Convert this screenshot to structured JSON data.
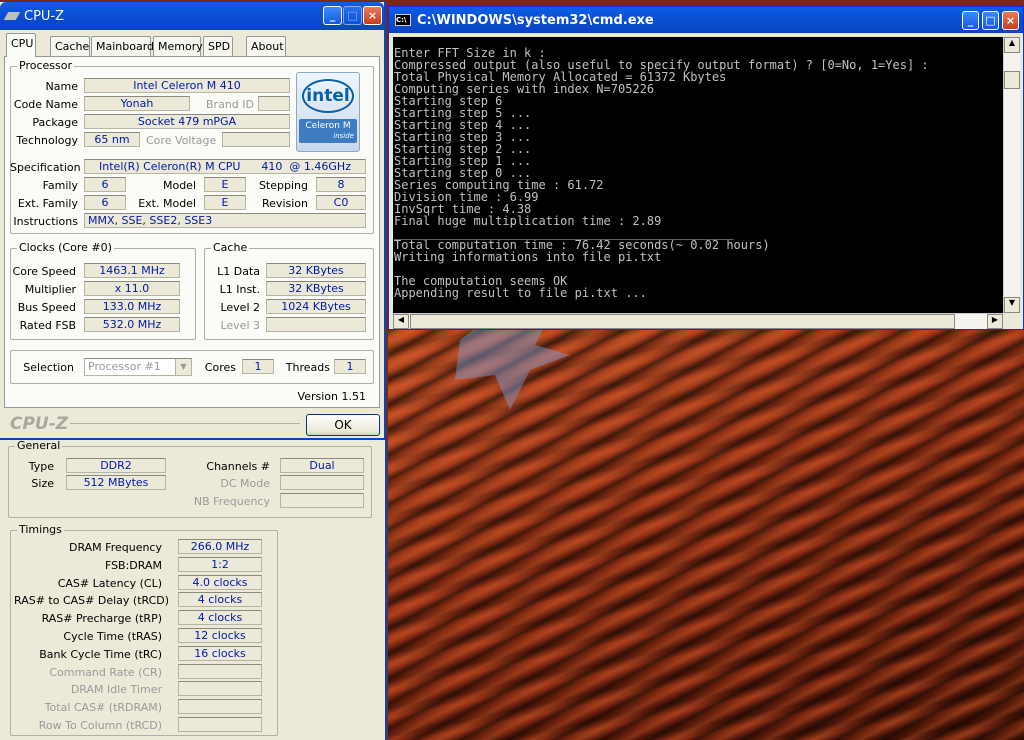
{
  "cpuz": {
    "title": "CPU-Z",
    "tabs": [
      "CPU",
      "Cache",
      "Mainboard",
      "Memory",
      "SPD",
      "About"
    ],
    "processor": {
      "legend": "Processor",
      "name_label": "Name",
      "name": "Intel Celeron M 410",
      "codename_label": "Code Name",
      "codename": "Yonah",
      "brandid_label": "Brand ID",
      "brandid": "",
      "package_label": "Package",
      "package": "Socket 479 mPGA",
      "technology_label": "Technology",
      "technology": "65 nm",
      "corevoltage_label": "Core Voltage",
      "corevoltage": "",
      "spec_label": "Specification",
      "spec": "Intel(R) Celeron(R) M CPU      410  @ 1.46GHz",
      "family_label": "Family",
      "family": "6",
      "model_label": "Model",
      "model": "E",
      "stepping_label": "Stepping",
      "stepping": "8",
      "extfamily_label": "Ext. Family",
      "extfamily": "6",
      "extmodel_label": "Ext. Model",
      "extmodel": "E",
      "revision_label": "Revision",
      "revision": "C0",
      "instructions_label": "Instructions",
      "instructions": "MMX, SSE, SSE2, SSE3",
      "logo_text": "intel",
      "logo_sub": "Celeron M",
      "logo_inside": "inside"
    },
    "clocks": {
      "legend": "Clocks (Core #0)",
      "corespeed_label": "Core Speed",
      "corespeed": "1463.1 MHz",
      "multiplier_label": "Multiplier",
      "multiplier": "x 11.0",
      "busspeed_label": "Bus Speed",
      "busspeed": "133.0 MHz",
      "ratedfsb_label": "Rated FSB",
      "ratedfsb": "532.0 MHz"
    },
    "cache": {
      "legend": "Cache",
      "l1data_label": "L1 Data",
      "l1data": "32 KBytes",
      "l1inst_label": "L1 Inst.",
      "l1inst": "32 KBytes",
      "level2_label": "Level 2",
      "level2": "1024 KBytes",
      "level3_label": "Level 3",
      "level3": ""
    },
    "selection_label": "Selection",
    "selection": "Processor #1",
    "cores_label": "Cores",
    "cores": "1",
    "threads_label": "Threads",
    "threads": "1",
    "version": "Version 1.51",
    "brand": "CPU-Z",
    "ok": "OK"
  },
  "memory": {
    "general_legend": "General",
    "type_label": "Type",
    "type": "DDR2",
    "size_label": "Size",
    "size": "512 MBytes",
    "channels_label": "Channels #",
    "channels": "Dual",
    "dcmode_label": "DC Mode",
    "dcmode": "",
    "nbfreq_label": "NB Frequency",
    "nbfreq": "",
    "timings_legend": "Timings",
    "timings": [
      {
        "label": "DRAM Frequency",
        "value": "266.0 MHz",
        "dim": false
      },
      {
        "label": "FSB:DRAM",
        "value": "1:2",
        "dim": false
      },
      {
        "label": "CAS# Latency (CL)",
        "value": "4.0 clocks",
        "dim": false
      },
      {
        "label": "RAS# to CAS# Delay (tRCD)",
        "value": "4 clocks",
        "dim": false
      },
      {
        "label": "RAS# Precharge (tRP)",
        "value": "4 clocks",
        "dim": false
      },
      {
        "label": "Cycle Time (tRAS)",
        "value": "12 clocks",
        "dim": false
      },
      {
        "label": "Bank Cycle Time (tRC)",
        "value": "16 clocks",
        "dim": false
      },
      {
        "label": "Command Rate (CR)",
        "value": "",
        "dim": true
      },
      {
        "label": "DRAM Idle Timer",
        "value": "",
        "dim": true
      },
      {
        "label": "Total CAS# (tRDRAM)",
        "value": "",
        "dim": true
      },
      {
        "label": "Row To Column (tRCD)",
        "value": "",
        "dim": true
      }
    ]
  },
  "cmd": {
    "title": "C:\\WINDOWS\\system32\\cmd.exe",
    "lines": [
      "Enter FFT Size in k :",
      "Compressed output (also useful to specify output format) ? [0=No, 1=Yes] :",
      "Total Physical Memory Allocated = 61372 Kbytes",
      "Computing series with index N=705226",
      "Starting step 6",
      "Starting step 5 ...",
      "Starting step 4 ...",
      "Starting step 3 ...",
      "Starting step 2 ...",
      "Starting step 1 ...",
      "Starting step 0 ...",
      "Series computing time : 61.72",
      "Division time : 6.99",
      "InvSqrt time : 4.38",
      "Final huge multiplication time : 2.89",
      "_______________________________________________",
      "Total computation time : 76.42 seconds(~ 0.02 hours)",
      "Writing informations into file pi.txt",
      "",
      "The computation seems OK",
      "Appending result to file pi.txt ..."
    ]
  },
  "colors": {
    "xp_blue": "#0845c3",
    "value_text": "#0019a8",
    "console_bg": "#000000",
    "console_fg": "#c0c0c0"
  }
}
